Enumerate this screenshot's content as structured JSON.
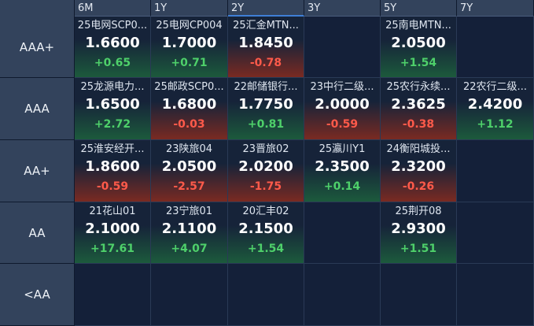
{
  "columns": [
    "6M",
    "1Y",
    "2Y",
    "3Y",
    "5Y",
    "7Y"
  ],
  "active_column": 2,
  "rows": [
    {
      "label": "AAA+",
      "cells": [
        {
          "name": "25电网SCP0...",
          "yield": "1.6600",
          "change": "+0.65",
          "dir": "up"
        },
        {
          "name": "25电网CP004",
          "yield": "1.7000",
          "change": "+0.71",
          "dir": "up"
        },
        {
          "name": "25汇金MTN...",
          "yield": "1.8450",
          "change": "-0.78",
          "dir": "down"
        },
        null,
        {
          "name": "25南电MTN...",
          "yield": "2.0500",
          "change": "+1.54",
          "dir": "up"
        },
        null
      ]
    },
    {
      "label": "AAA",
      "cells": [
        {
          "name": "25龙源电力...",
          "yield": "1.6500",
          "change": "+2.72",
          "dir": "up"
        },
        {
          "name": "25邮政SCP0...",
          "yield": "1.6800",
          "change": "-0.03",
          "dir": "down"
        },
        {
          "name": "22邮储银行...",
          "yield": "1.7750",
          "change": "+0.81",
          "dir": "up"
        },
        {
          "name": "23中行二级...",
          "yield": "2.0000",
          "change": "-0.59",
          "dir": "down"
        },
        {
          "name": "25农行永续...",
          "yield": "2.3625",
          "change": "-0.38",
          "dir": "down"
        },
        {
          "name": "22农行二级...",
          "yield": "2.4200",
          "change": "+1.12",
          "dir": "up"
        }
      ]
    },
    {
      "label": "AA+",
      "cells": [
        {
          "name": "25淮安经开...",
          "yield": "1.8600",
          "change": "-0.59",
          "dir": "down"
        },
        {
          "name": "23陕旅04",
          "yield": "2.0500",
          "change": "-2.57",
          "dir": "down"
        },
        {
          "name": "23晋旅02",
          "yield": "2.0200",
          "change": "-1.75",
          "dir": "down"
        },
        {
          "name": "25瀛川Y1",
          "yield": "2.3500",
          "change": "+0.14",
          "dir": "up"
        },
        {
          "name": "24衡阳城投...",
          "yield": "2.3200",
          "change": "-0.26",
          "dir": "down"
        },
        null
      ]
    },
    {
      "label": "AA",
      "cells": [
        {
          "name": "21花山01",
          "yield": "2.1000",
          "change": "+17.61",
          "dir": "up"
        },
        {
          "name": "23宁旅01",
          "yield": "2.1100",
          "change": "+4.07",
          "dir": "up"
        },
        {
          "name": "20汇丰02",
          "yield": "2.1500",
          "change": "+1.54",
          "dir": "up"
        },
        null,
        {
          "name": "25荆开08",
          "yield": "2.9300",
          "change": "+1.51",
          "dir": "up"
        },
        null
      ]
    },
    {
      "label": "<AA",
      "cells": [
        null,
        null,
        null,
        null,
        null,
        null
      ]
    }
  ]
}
